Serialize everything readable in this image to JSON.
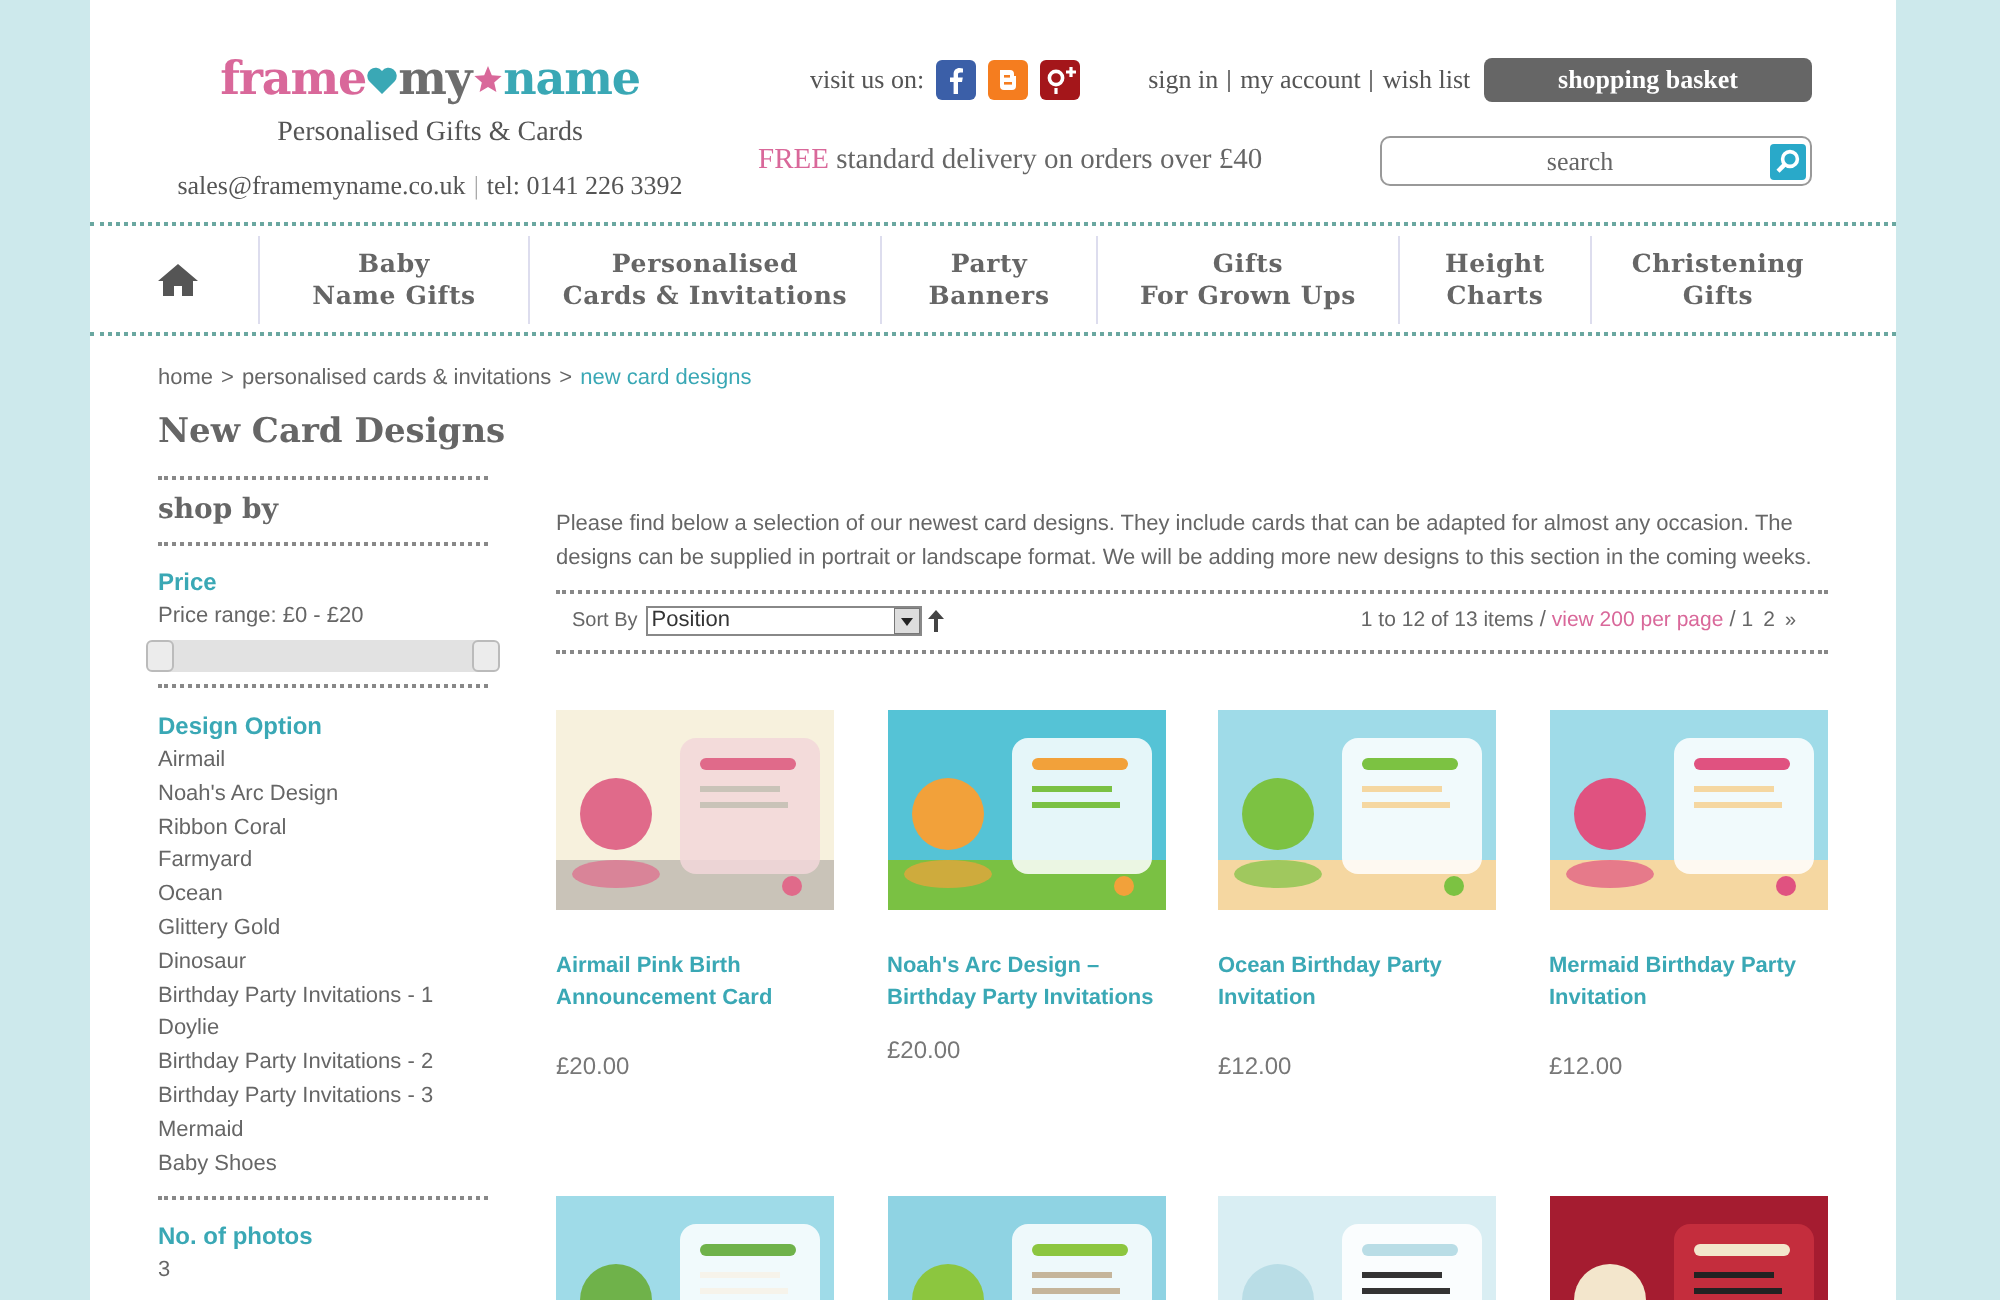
{
  "header": {
    "logo": [
      "frame",
      "my",
      "name"
    ],
    "tagline": "Personalised Gifts & Cards",
    "contact": [
      "sales@framemyname.co.uk",
      "|",
      "tel: 0141 226 3392"
    ],
    "social_label": "visit us on:",
    "account_links": [
      "sign in",
      "my account",
      "wish list"
    ],
    "basket_button": "shopping basket",
    "delivery": {
      "highlight": "FREE",
      "text": "standard delivery on orders over £40"
    },
    "search": {
      "placeholder": "search"
    }
  },
  "nav": [
    {
      "lines": [
        "Baby",
        "Name Gifts"
      ]
    },
    {
      "lines": [
        "Personalised",
        "Cards & Invitations"
      ]
    },
    {
      "lines": [
        "Party",
        "Banners"
      ]
    },
    {
      "lines": [
        "Gifts",
        "For Grown Ups"
      ]
    },
    {
      "lines": [
        "Height",
        "Charts"
      ]
    },
    {
      "lines": [
        "Christening",
        "Gifts"
      ]
    }
  ],
  "breadcrumb": [
    {
      "label": "home",
      "current": false
    },
    {
      "label": "personalised cards & invitations",
      "current": false
    },
    {
      "label": "new card designs",
      "current": true
    }
  ],
  "breadcrumb_separator": ">",
  "page_title": "New Card Designs",
  "sidebar": {
    "heading": "shop by",
    "price": {
      "title": "Price",
      "range": "Price range: £0 - £20",
      "handles": [
        {
          "level": 0
        },
        {
          "level": 1
        }
      ]
    },
    "design_option": {
      "title": "Design Option",
      "items": [
        "Airmail",
        "Noah's Arc Design",
        "Ribbon Coral",
        "Farmyard",
        "Ocean",
        "Glittery Gold",
        "Dinosaur",
        "Birthday Party Invitations - 1",
        "Doylie",
        "Birthday Party Invitations - 2",
        "Birthday Party Invitations - 3",
        "Mermaid",
        "Baby Shoes"
      ]
    },
    "photos": {
      "title": "No. of photos",
      "items": [
        "3"
      ]
    }
  },
  "intro": "Please find below a selection of our newest card designs. They include cards that can be adapted for almost any occasion. The designs can be supplied in portrait or landscape format. We will be adding more new designs to this section in the coming weeks.",
  "toolbar": {
    "sort_label": "Sort By",
    "sort_value": "Position",
    "count": "1 to 12 of 13 items",
    "separator": "/",
    "per_page": "view 200 per page",
    "pages": [
      "1",
      "2"
    ],
    "next": "»"
  },
  "products": [
    {
      "kind": "product",
      "name": "Airmail Pink Birth Announcement Card",
      "price": "£20.00"
    },
    {
      "kind": "product",
      "name": "Noah's Arc Design – Birthday Party Invitations",
      "price": "£20.00"
    },
    {
      "kind": "product",
      "name": "Ocean Birthday Party Invitation",
      "price": "£12.00"
    },
    {
      "kind": "product",
      "name": "Mermaid Birthday Party Invitation",
      "price": "£12.00"
    },
    {
      "kind": "picture"
    },
    {
      "kind": "picture"
    },
    {
      "kind": "picture"
    },
    {
      "kind": "picture"
    }
  ]
}
